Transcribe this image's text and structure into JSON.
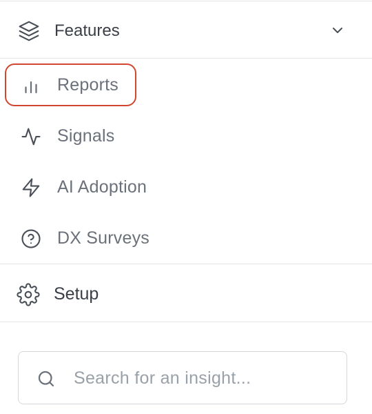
{
  "section": {
    "label": "Features",
    "icon": "layers-icon",
    "expanded": true
  },
  "nav": {
    "items": [
      {
        "label": "Reports",
        "icon": "bar-chart-icon",
        "highlighted": true
      },
      {
        "label": "Signals",
        "icon": "activity-icon"
      },
      {
        "label": "AI Adoption",
        "icon": "lightning-icon"
      },
      {
        "label": "DX Surveys",
        "icon": "help-circle-icon"
      }
    ]
  },
  "setup": {
    "label": "Setup",
    "icon": "gear-icon"
  },
  "search": {
    "value": "",
    "placeholder": "Search for an insight..."
  },
  "colors": {
    "highlight_border": "#d2452f",
    "divider": "#e3e5e8",
    "muted_text": "#6b717a",
    "dark_text": "#3a3f47"
  }
}
